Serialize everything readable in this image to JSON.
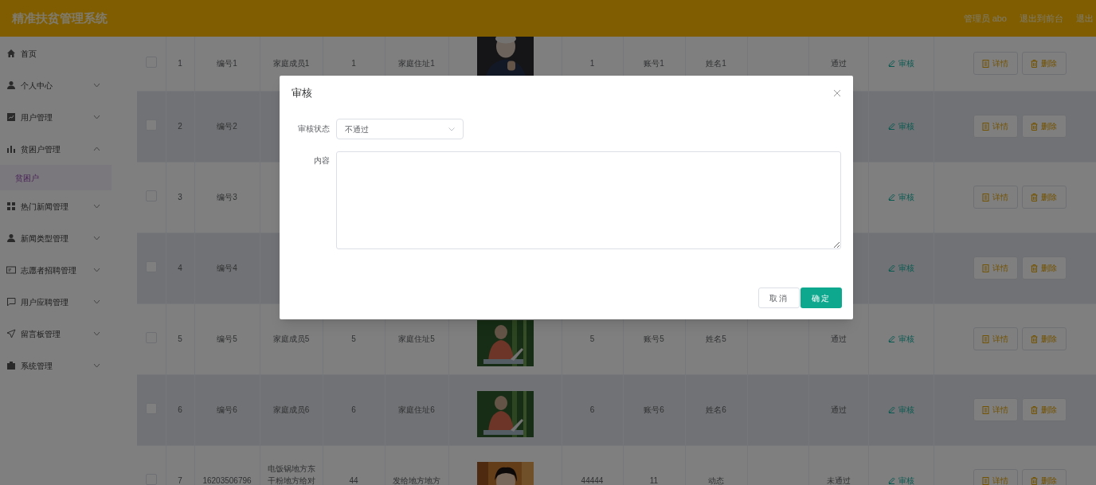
{
  "header": {
    "title": "精准扶贫管理系统",
    "user": "管理员 abo",
    "links": [
      "退出到前台",
      "退出"
    ]
  },
  "sidebar": {
    "items": [
      {
        "label": "首页"
      },
      {
        "label": "个人中心",
        "expanded": false
      },
      {
        "label": "用户管理",
        "expanded": false
      },
      {
        "label": "贫困户管理",
        "expanded": true,
        "children": [
          {
            "label": "贫困户",
            "selected": true
          }
        ]
      },
      {
        "label": "热门新闻管理",
        "expanded": false
      },
      {
        "label": "新闻类型管理",
        "expanded": false
      },
      {
        "label": "志愿者招聘管理",
        "expanded": false
      },
      {
        "label": "用户应聘管理",
        "expanded": false
      },
      {
        "label": "留言板管理",
        "expanded": false
      },
      {
        "label": "系统管理",
        "expanded": false
      }
    ]
  },
  "table": {
    "striped": true,
    "rows": [
      {
        "checked": false,
        "cells": {
          "index": "1",
          "number": "编号1",
          "member": "家庭成员1",
          "column_5": "1",
          "address": "家庭住址1",
          "column_8": "1",
          "account": "账号1",
          "name": "姓名1",
          "status": "通过"
        },
        "review": "审核",
        "buttons": [
          "详情",
          "删除"
        ]
      },
      {
        "checked": false,
        "cells": {
          "index": "2",
          "number": "编号2"
        },
        "review": "审核",
        "buttons": [
          "详情",
          "删除"
        ]
      },
      {
        "checked": false,
        "cells": {
          "index": "3",
          "number": "编号3"
        },
        "review": "审核",
        "buttons": [
          "详情",
          "删除"
        ]
      },
      {
        "checked": false,
        "cells": {
          "index": "4",
          "number": "编号4"
        },
        "review": "审核",
        "buttons": [
          "详情",
          "删除"
        ]
      },
      {
        "checked": false,
        "cells": {
          "index": "5",
          "number": "编号5",
          "member": "家庭成员5",
          "column_5": "5",
          "address": "家庭住址5",
          "column_8": "5",
          "account": "账号5",
          "name": "姓名5",
          "status": "通过"
        },
        "review": "审核",
        "buttons": [
          "详情",
          "删除"
        ]
      },
      {
        "checked": false,
        "cells": {
          "index": "6",
          "number": "编号6",
          "member": "家庭成员6",
          "column_5": "6",
          "address": "家庭住址6",
          "column_8": "6",
          "account": "账号6",
          "name": "姓名6",
          "status": "通过"
        },
        "review": "审核",
        "buttons": [
          "详情",
          "删除"
        ]
      },
      {
        "checked": false,
        "cells": {
          "index": "7",
          "number": "16203506796",
          "member": "电饭锅地方东干粉地方给对",
          "column_5": "44",
          "address": "发给地方地方",
          "column_8": "44444",
          "account": "11",
          "name": "动态",
          "status": "未通过"
        },
        "review": "审核",
        "buttons": [
          "详情",
          "删除"
        ]
      }
    ]
  },
  "dialog": {
    "title": "审核",
    "fields": [
      {
        "kind": "select",
        "label": "审核状态",
        "value": "不通过"
      },
      {
        "kind": "textarea",
        "label": "内容"
      }
    ],
    "buttons": [
      {
        "label": "取消",
        "primary": false
      },
      {
        "label": "确定",
        "primary": true
      }
    ]
  }
}
